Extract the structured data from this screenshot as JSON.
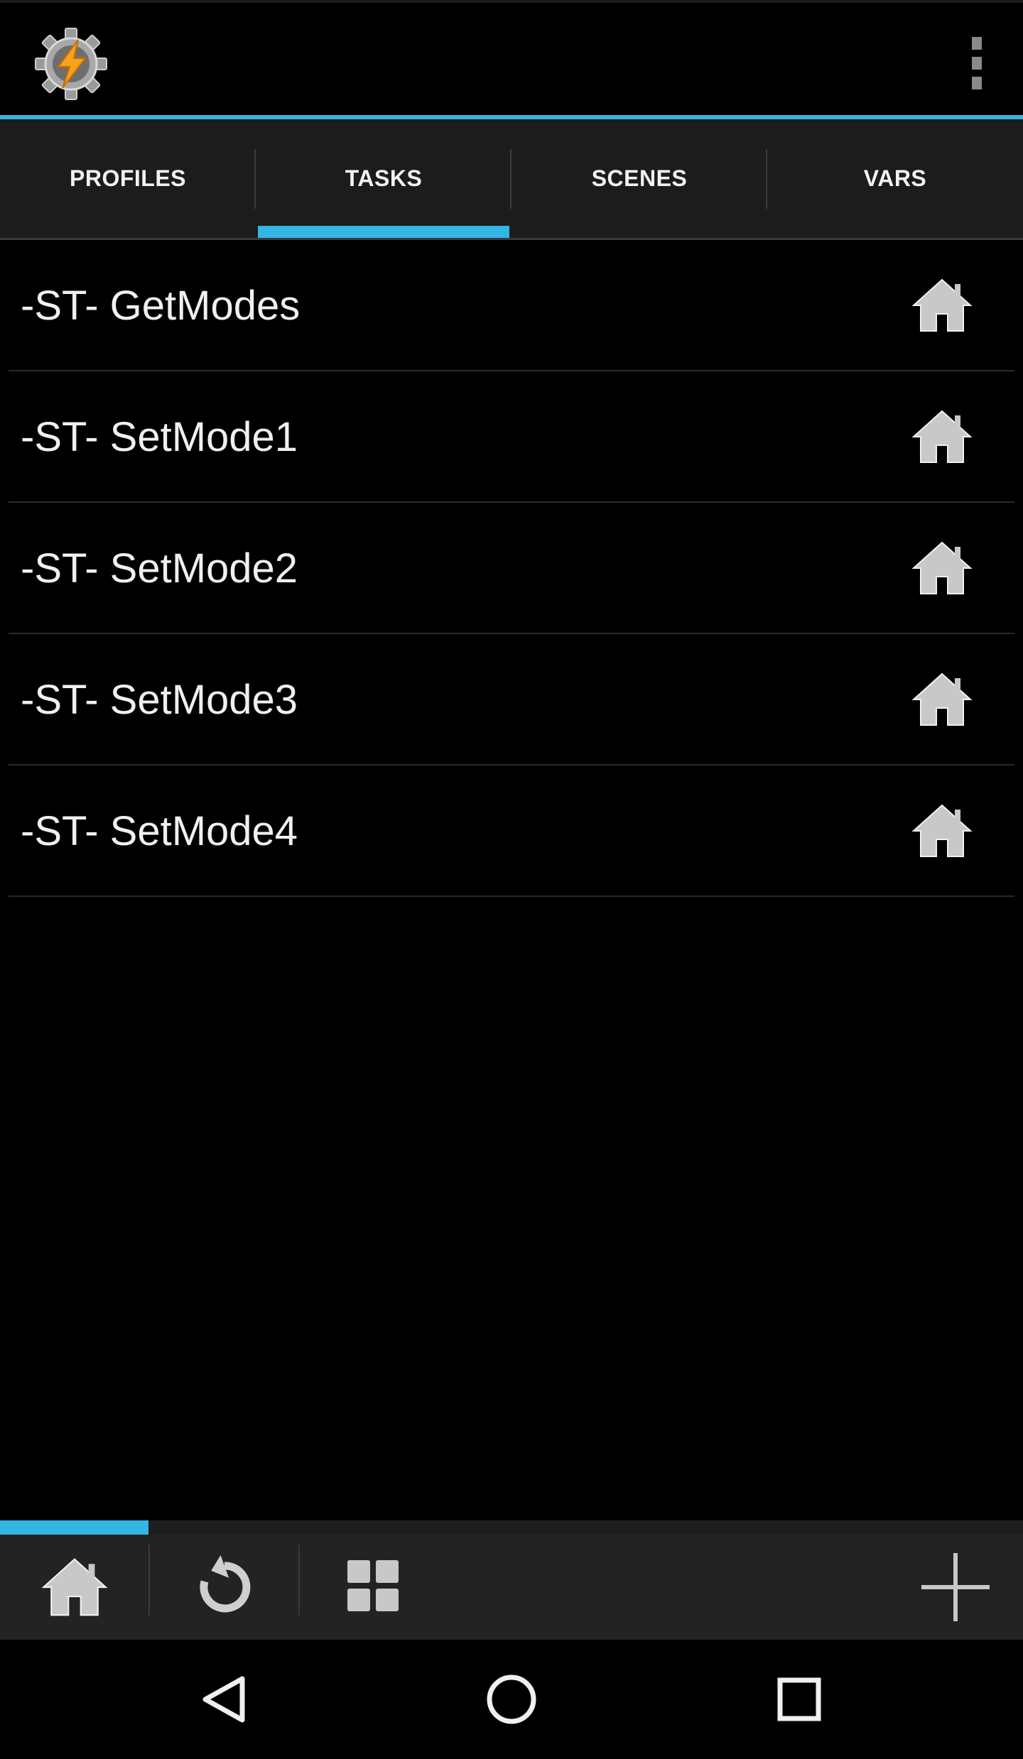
{
  "app": {
    "logo_icon": "tasker-gear-lightning-icon",
    "menu_icon": "overflow-menu-icon"
  },
  "colors": {
    "accent": "#33b5e5",
    "background": "#000000",
    "tab_bar": "#1c1c1c",
    "bottom_bar": "#232323"
  },
  "tabs": [
    {
      "label": "PROFILES",
      "selected": false
    },
    {
      "label": "TASKS",
      "selected": true
    },
    {
      "label": "SCENES",
      "selected": false
    },
    {
      "label": "VARS",
      "selected": false
    }
  ],
  "tasks": [
    {
      "name": "-ST- GetModes",
      "icon": "home-icon"
    },
    {
      "name": "-ST- SetMode1",
      "icon": "home-icon"
    },
    {
      "name": "-ST- SetMode2",
      "icon": "home-icon"
    },
    {
      "name": "-ST- SetMode3",
      "icon": "home-icon"
    },
    {
      "name": "-ST- SetMode4",
      "icon": "home-icon"
    }
  ],
  "bottom_toolbar": {
    "progress_fraction": 0.145,
    "buttons": [
      {
        "icon": "home-icon"
      },
      {
        "icon": "refresh-icon"
      },
      {
        "icon": "grid-icon"
      },
      {
        "icon": "add-icon"
      }
    ]
  },
  "nav_bar": {
    "buttons": [
      "back-icon",
      "home-circle-icon",
      "recents-icon"
    ]
  }
}
